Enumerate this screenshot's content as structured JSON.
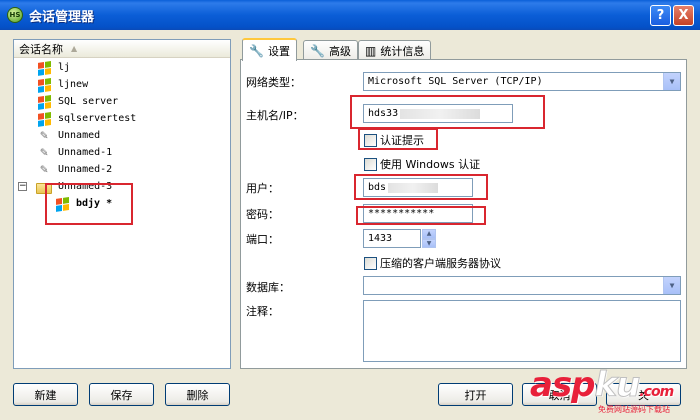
{
  "window": {
    "app_icon_text": "HS",
    "title": "会话管理器",
    "help_button": "?",
    "close_button": "X"
  },
  "session_list": {
    "column_header": "会话名称",
    "items": [
      {
        "label": "lj",
        "icon": "windows-flag-icon"
      },
      {
        "label": "ljnew",
        "icon": "windows-flag-icon"
      },
      {
        "label": "SQL server",
        "icon": "windows-flag-icon"
      },
      {
        "label": "sqlservertest",
        "icon": "windows-flag-icon"
      },
      {
        "label": "Unnamed",
        "icon": "wrench-icon"
      },
      {
        "label": "Unnamed-1",
        "icon": "wrench-icon"
      },
      {
        "label": "Unnamed-2",
        "icon": "wrench-icon"
      },
      {
        "label": "Unnamed-3",
        "icon": "folder-icon",
        "expander": "−"
      },
      {
        "label": "bdjy *",
        "icon": "windows-flag-icon",
        "selected": true
      }
    ]
  },
  "tabs": [
    {
      "label": "设置",
      "icon": "wrench-icon",
      "active": true
    },
    {
      "label": "高级",
      "icon": "wrench-icon"
    },
    {
      "label": "统计信息",
      "icon": "bar-chart-icon"
    }
  ],
  "settings": {
    "network_type_label": "网络类型：",
    "network_type_value": "Microsoft SQL Server (TCP/IP)",
    "host_label": "主机名/IP：",
    "host_value": "hds33",
    "auth_prompt_label": "认证提示",
    "windows_auth_label": "使用 Windows 认证",
    "user_label": "用户：",
    "user_value": "bds",
    "password_label": "密码：",
    "password_value": "***********",
    "port_label": "端口：",
    "port_value": "1433",
    "compression_label": "压缩的客户端服务器协议",
    "database_label": "数据库：",
    "database_value": "",
    "comment_label": "注释："
  },
  "buttons": {
    "new": "新建",
    "save": "保存",
    "delete": "删除",
    "open": "打开",
    "cancel": "取消",
    "close": "关"
  },
  "watermark": {
    "brand_a": "asp",
    "brand_b": "ku",
    "brand_c": ".com",
    "sub": "免费网站源码下载站"
  },
  "colors": {
    "title_bar": "#0B5ED7",
    "annotation_red": "#d9262f",
    "watermark_red": "#e8203a"
  }
}
